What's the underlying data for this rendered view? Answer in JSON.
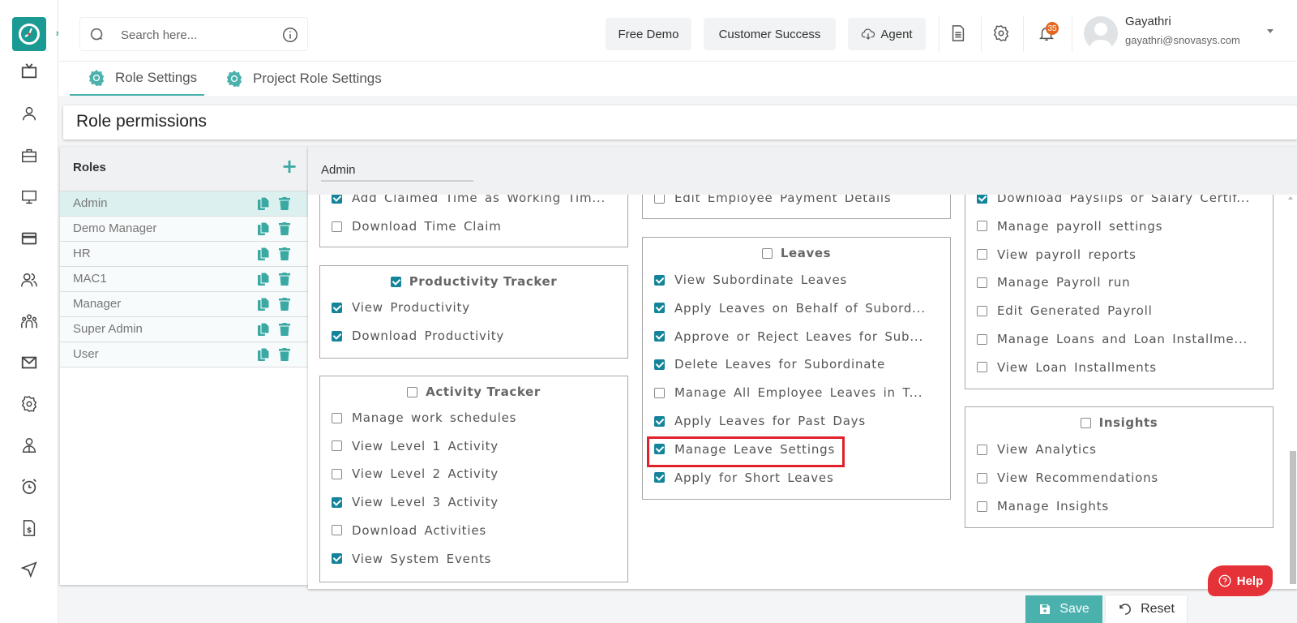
{
  "header": {
    "search_placeholder": "Search here...",
    "buttons": {
      "free_demo": "Free Demo",
      "customer_success": "Customer Success",
      "agent": "Agent"
    },
    "notification_count": "35",
    "user": {
      "name": "Gayathri",
      "email": "gayathri@snovasys.com"
    }
  },
  "tabs": [
    {
      "label": "Role Settings",
      "active": true
    },
    {
      "label": "Project Role Settings",
      "active": false
    }
  ],
  "page_title": "Role permissions",
  "roles": {
    "title": "Roles",
    "add_icon": "+",
    "items": [
      {
        "name": "Admin",
        "selected": true
      },
      {
        "name": "Demo Manager",
        "selected": false
      },
      {
        "name": "HR",
        "selected": false
      },
      {
        "name": "MAC1",
        "selected": false
      },
      {
        "name": "Manager",
        "selected": false
      },
      {
        "name": "Super Admin",
        "selected": false
      },
      {
        "name": "User",
        "selected": false
      }
    ]
  },
  "selected_role_value": "Admin",
  "permissions": {
    "time_claim": {
      "items": [
        {
          "label": "Add Claimed Time as Working Tim...",
          "checked": true
        },
        {
          "label": "Download Time Claim",
          "checked": false
        }
      ]
    },
    "productivity_tracker": {
      "title": "Productivity Tracker",
      "checked": true,
      "items": [
        {
          "label": "View Productivity",
          "checked": true
        },
        {
          "label": "Download Productivity",
          "checked": true
        }
      ]
    },
    "activity_tracker": {
      "title": "Activity Tracker",
      "checked": false,
      "items": [
        {
          "label": "Manage work schedules",
          "checked": false
        },
        {
          "label": "View Level 1 Activity",
          "checked": false
        },
        {
          "label": "View Level 2 Activity",
          "checked": false
        },
        {
          "label": "View Level 3 Activity",
          "checked": true
        },
        {
          "label": "Download Activities",
          "checked": false
        },
        {
          "label": "View System Events",
          "checked": true
        }
      ]
    },
    "employee_payment": {
      "items": [
        {
          "label": "Edit Employee Payment Details",
          "checked": false
        }
      ]
    },
    "leaves": {
      "title": "Leaves",
      "checked": false,
      "items": [
        {
          "label": "View Subordinate Leaves",
          "checked": true
        },
        {
          "label": "Apply Leaves on Behalf of Subord...",
          "checked": true
        },
        {
          "label": "Approve or Reject Leaves for Sub...",
          "checked": true
        },
        {
          "label": "Delete Leaves for Subordinate",
          "checked": true
        },
        {
          "label": "Manage All Employee Leaves in T...",
          "checked": false
        },
        {
          "label": "Apply Leaves for Past Days",
          "checked": true
        },
        {
          "label": "Manage Leave Settings",
          "checked": true,
          "highlighted": true
        },
        {
          "label": "Apply for Short Leaves",
          "checked": true
        }
      ]
    },
    "payroll": {
      "items": [
        {
          "label": "Download Payslips or Salary Certif...",
          "checked": true
        },
        {
          "label": "Manage payroll settings",
          "checked": false
        },
        {
          "label": "View payroll reports",
          "checked": false
        },
        {
          "label": "Manage Payroll run",
          "checked": false
        },
        {
          "label": "Edit Generated Payroll",
          "checked": false
        },
        {
          "label": "Manage Loans and Loan Installme...",
          "checked": false
        },
        {
          "label": "View Loan Installments",
          "checked": false
        }
      ]
    },
    "insights": {
      "title": "Insights",
      "checked": false,
      "items": [
        {
          "label": "View Analytics",
          "checked": false
        },
        {
          "label": "View Recommendations",
          "checked": false
        },
        {
          "label": "Manage Insights",
          "checked": false
        }
      ]
    }
  },
  "actions": {
    "help": "Help",
    "save": "Save",
    "reset": "Reset"
  },
  "colors": {
    "brand": "#1a9a93",
    "accent": "#4ab1ad",
    "checkbox": "#14849b",
    "help": "#e53238",
    "highlight": "#e0202a",
    "badge": "#e5671f"
  }
}
